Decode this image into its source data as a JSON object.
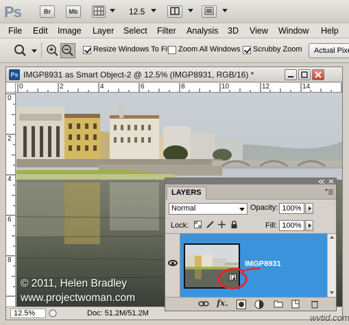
{
  "appbar": {
    "logo": "Ps",
    "bridge_label": "Br",
    "minibridge_label": "Mb",
    "zoom_value": "12.5"
  },
  "menu": [
    "File",
    "Edit",
    "Image",
    "Layer",
    "Select",
    "Filter",
    "Analysis",
    "3D",
    "View",
    "Window",
    "Help"
  ],
  "options": {
    "resize_windows": {
      "label": "Resize Windows To Fit",
      "checked": true
    },
    "zoom_all": {
      "label": "Zoom All Windows",
      "checked": false
    },
    "scrubby": {
      "label": "Scrubby Zoom",
      "checked": true
    },
    "actual_pixels": "Actual Pixels"
  },
  "document": {
    "title": "IMGP8931 as Smart Object-2 @ 12.5% (IMGP8931, RGB/16) *",
    "ruler_top": [
      "0",
      "2",
      "4",
      "6",
      "8",
      "10",
      "12",
      "14"
    ],
    "ruler_left": [
      "0",
      "2",
      "4",
      "6",
      "8"
    ],
    "watermark_line1": "© 2011, Helen Bradley",
    "watermark_line2": "www.projectwoman.com",
    "status_zoom": "12.5%",
    "status_doc": "Doc: 51.2M/51.2M"
  },
  "layers": {
    "tab": "LAYERS",
    "blend_mode": "Normal",
    "opacity_label": "Opacity:",
    "opacity_value": "100%",
    "lock_label": "Lock:",
    "fill_label": "Fill:",
    "fill_value": "100%",
    "layer_name": "IMGP8931"
  },
  "footer_mark": "wvtid.com"
}
